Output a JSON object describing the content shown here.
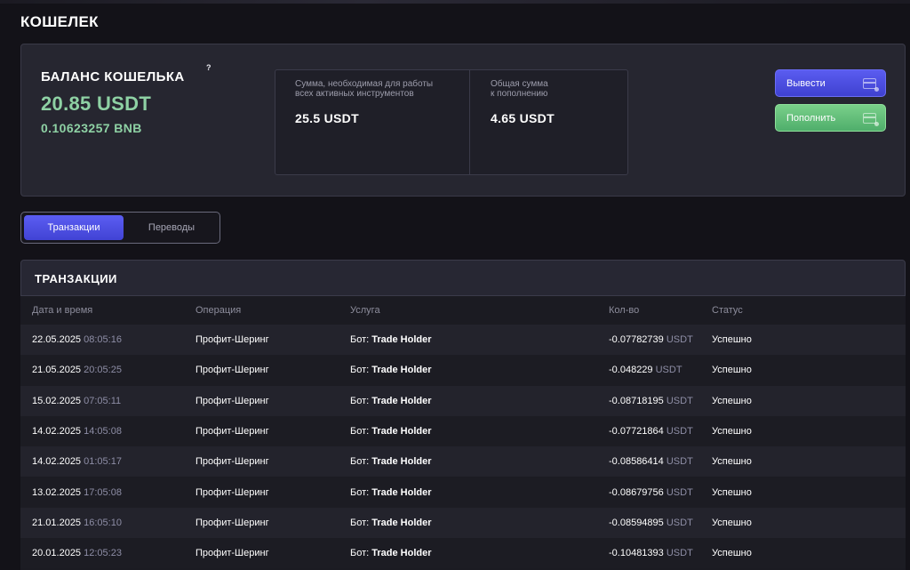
{
  "page": {
    "title": "КОШЕЛЕК"
  },
  "balance": {
    "title": "БАЛАНС КОШЕЛЬКА",
    "help": "?",
    "usdt": "20.85 USDT",
    "bnb": "0.10623257 BNB",
    "required_label": "Сумма, необходимая для работы\nвсех активных инструментов",
    "required_value": "25.5 USDT",
    "topup_label": "Общая сумма\nк пополнению",
    "topup_value": "4.65 USDT",
    "withdraw_label": "Вывести",
    "deposit_label": "Пополнить"
  },
  "tabs": [
    {
      "label": "Транзакции",
      "active": true
    },
    {
      "label": "Переводы",
      "active": false
    }
  ],
  "transactions": {
    "title": "ТРАНЗАКЦИИ",
    "columns": [
      "Дата и время",
      "Операция",
      "Услуга",
      "Кол-во",
      "Статус"
    ],
    "rows": [
      {
        "date": "22.05.2025",
        "time": "08:05:16",
        "operation": "Профит-Шеринг",
        "service_prefix": "Бот:",
        "service_name": "Trade Holder",
        "amount": "-0.07782739",
        "unit": "USDT",
        "status": "Успешно"
      },
      {
        "date": "21.05.2025",
        "time": "20:05:25",
        "operation": "Профит-Шеринг",
        "service_prefix": "Бот:",
        "service_name": "Trade Holder",
        "amount": "-0.048229",
        "unit": "USDT",
        "status": "Успешно"
      },
      {
        "date": "15.02.2025",
        "time": "07:05:11",
        "operation": "Профит-Шеринг",
        "service_prefix": "Бот:",
        "service_name": "Trade Holder",
        "amount": "-0.08718195",
        "unit": "USDT",
        "status": "Успешно"
      },
      {
        "date": "14.02.2025",
        "time": "14:05:08",
        "operation": "Профит-Шеринг",
        "service_prefix": "Бот:",
        "service_name": "Trade Holder",
        "amount": "-0.07721864",
        "unit": "USDT",
        "status": "Успешно"
      },
      {
        "date": "14.02.2025",
        "time": "01:05:17",
        "operation": "Профит-Шеринг",
        "service_prefix": "Бот:",
        "service_name": "Trade Holder",
        "amount": "-0.08586414",
        "unit": "USDT",
        "status": "Успешно"
      },
      {
        "date": "13.02.2025",
        "time": "17:05:08",
        "operation": "Профит-Шеринг",
        "service_prefix": "Бот:",
        "service_name": "Trade Holder",
        "amount": "-0.08679756",
        "unit": "USDT",
        "status": "Успешно"
      },
      {
        "date": "21.01.2025",
        "time": "16:05:10",
        "operation": "Профит-Шеринг",
        "service_prefix": "Бот:",
        "service_name": "Trade Holder",
        "amount": "-0.08594895",
        "unit": "USDT",
        "status": "Успешно"
      },
      {
        "date": "20.01.2025",
        "time": "12:05:23",
        "operation": "Профит-Шеринг",
        "service_prefix": "Бот:",
        "service_name": "Trade Holder",
        "amount": "-0.10481393",
        "unit": "USDT",
        "status": "Успешно"
      }
    ]
  }
}
